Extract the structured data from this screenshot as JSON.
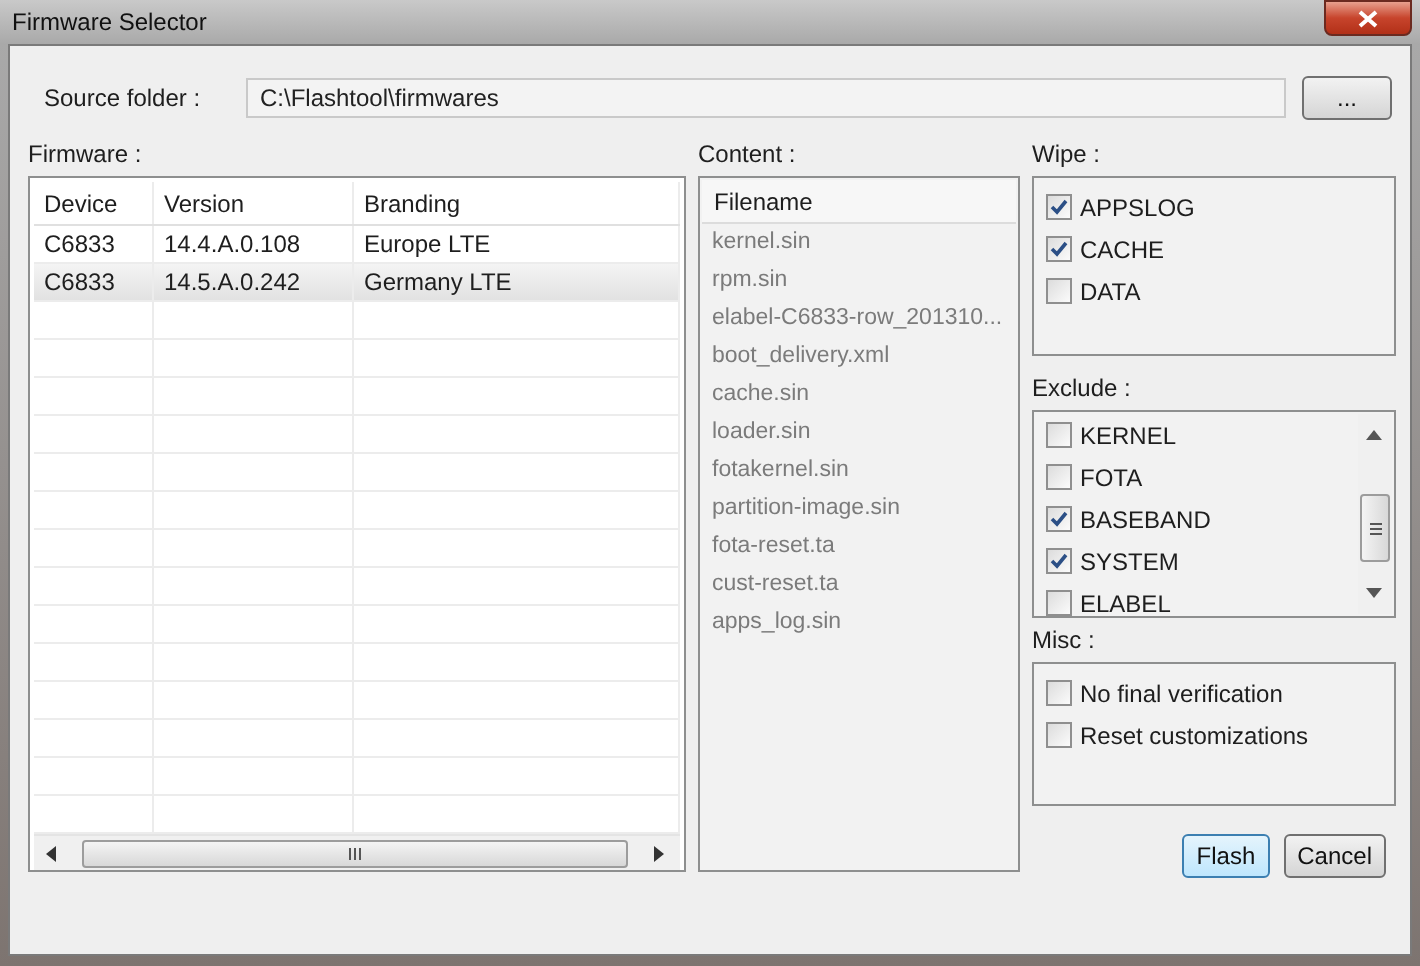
{
  "window": {
    "title": "Firmware Selector"
  },
  "source_folder": {
    "label": "Source folder :",
    "value": "C:\\Flashtool\\firmwares",
    "browse_button": "..."
  },
  "firmware": {
    "label": "Firmware :",
    "columns": [
      "Device",
      "Version",
      "Branding"
    ],
    "rows": [
      {
        "cells": [
          "C6833",
          "14.4.A.0.108",
          "Europe LTE"
        ],
        "selected": false
      },
      {
        "cells": [
          "C6833",
          "14.5.A.0.242",
          "Germany LTE"
        ],
        "selected": true
      }
    ]
  },
  "content": {
    "label": "Content :",
    "column": "Filename",
    "files": [
      "kernel.sin",
      "rpm.sin",
      "elabel-C6833-row_201310...",
      "boot_delivery.xml",
      "cache.sin",
      "loader.sin",
      "fotakernel.sin",
      "partition-image.sin",
      "fota-reset.ta",
      "cust-reset.ta",
      "apps_log.sin"
    ]
  },
  "wipe": {
    "label": "Wipe :",
    "items": [
      {
        "label": "APPSLOG",
        "checked": true
      },
      {
        "label": "CACHE",
        "checked": true
      },
      {
        "label": "DATA",
        "checked": false
      }
    ]
  },
  "exclude": {
    "label": "Exclude :",
    "items": [
      {
        "label": "KERNEL",
        "checked": false
      },
      {
        "label": "FOTA",
        "checked": false
      },
      {
        "label": "BASEBAND",
        "checked": true
      },
      {
        "label": "SYSTEM",
        "checked": true
      },
      {
        "label": "ELABEL",
        "checked": false
      }
    ]
  },
  "misc": {
    "label": "Misc :",
    "items": [
      {
        "label": "No final verification",
        "checked": false
      },
      {
        "label": "Reset customizations",
        "checked": false
      }
    ]
  },
  "buttons": [
    {
      "label": "Flash",
      "kind": "default"
    },
    {
      "label": "Cancel",
      "kind": "normal"
    }
  ]
}
